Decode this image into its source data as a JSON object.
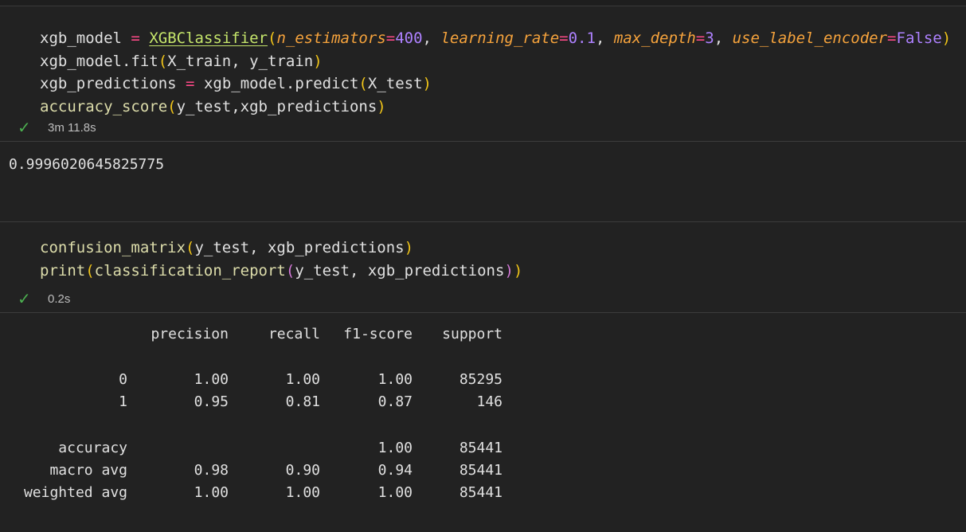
{
  "cell1": {
    "lines": [
      {
        "assign_var": "xgb_model",
        "eq": "=",
        "cls": "XGBClassifier",
        "open": "(",
        "p1": "n_estimators",
        "p1eq": "=",
        "p1v": "400",
        "c1": ", ",
        "p2": "learning_rate",
        "p2eq": "=",
        "p2v": "0.1",
        "c2": ", ",
        "p3": "max_depth",
        "p3eq": "=",
        "p3v": "3",
        "c3": ", ",
        "p4": "use_label_encoder",
        "p4eq": "=",
        "p4v": "False",
        "close": ")"
      },
      {
        "text": "xgb_model.fit",
        "open": "(",
        "args": "X_train, y_train",
        "close": ")"
      },
      {
        "assign_var": "xgb_predictions",
        "eq": "=",
        "call": "xgb_model.predict",
        "open": "(",
        "args": "X_test",
        "close": ")"
      },
      {
        "fn": "accuracy_score",
        "open": "(",
        "args": "y_test,xgb_predictions",
        "close": ")"
      }
    ],
    "status_icon": "checkmark-icon",
    "duration": "3m 11.8s",
    "output": "0.9996020645825775"
  },
  "cell2": {
    "lines": [
      {
        "fn": "confusion_matrix",
        "open": "(",
        "args": "y_test, xgb_predictions",
        "close": ")"
      },
      {
        "fn": "print",
        "open": "(",
        "inner_fn": "classification_report",
        "inner_open": "(",
        "args": "y_test, xgb_predictions",
        "inner_close": ")",
        "close": ")"
      }
    ],
    "status_icon": "checkmark-icon",
    "duration": "0.2s"
  },
  "report": {
    "headers": [
      "precision",
      "recall",
      "f1-score",
      "support"
    ],
    "rows": [
      {
        "label": "0",
        "precision": "1.00",
        "recall": "1.00",
        "f1": "1.00",
        "support": "85295"
      },
      {
        "label": "1",
        "precision": "0.95",
        "recall": "0.81",
        "f1": "0.87",
        "support": "146"
      },
      {
        "label": "accuracy",
        "precision": "",
        "recall": "",
        "f1": "1.00",
        "support": "85441"
      },
      {
        "label": "macro avg",
        "precision": "0.98",
        "recall": "0.90",
        "f1": "0.94",
        "support": "85441"
      },
      {
        "label": "weighted avg",
        "precision": "1.00",
        "recall": "1.00",
        "f1": "1.00",
        "support": "85441"
      }
    ]
  },
  "colors": {
    "background": "#1e1e1e",
    "success": "#4caf50",
    "function": "#dcdcaa",
    "parameter": "#f6a33c",
    "number": "#ae81ff",
    "operator": "#ff4a88"
  }
}
